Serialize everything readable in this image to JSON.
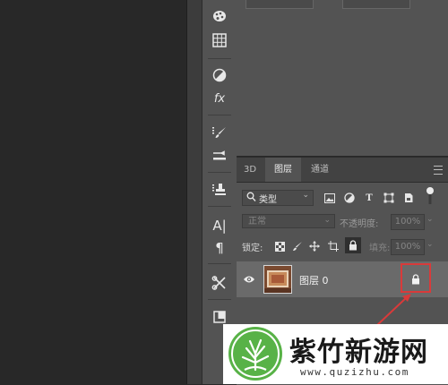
{
  "layers_panel": {
    "tabs": [
      {
        "label": "3D"
      },
      {
        "label": "图层"
      },
      {
        "label": "通道"
      }
    ],
    "filter": {
      "label": "类型"
    },
    "blend": {
      "mode": "正常",
      "opacity_label": "不透明度:",
      "opacity_value": "100%"
    },
    "lock": {
      "label": "锁定:",
      "fill_label": "填充:",
      "fill_value": "100%"
    },
    "layers": [
      {
        "name": "图层 0",
        "visible": true,
        "locked": true
      }
    ]
  },
  "tools": {
    "type_icon": "A|",
    "paragraph_icon": "¶",
    "fx_icon": "fx"
  },
  "watermark": {
    "title": "紫竹新游网",
    "url": "www.quzizhu.com"
  },
  "colors": {
    "panel_bg": "#535353",
    "highlight_red": "#d93a3a",
    "watermark_green": "#58b247"
  }
}
